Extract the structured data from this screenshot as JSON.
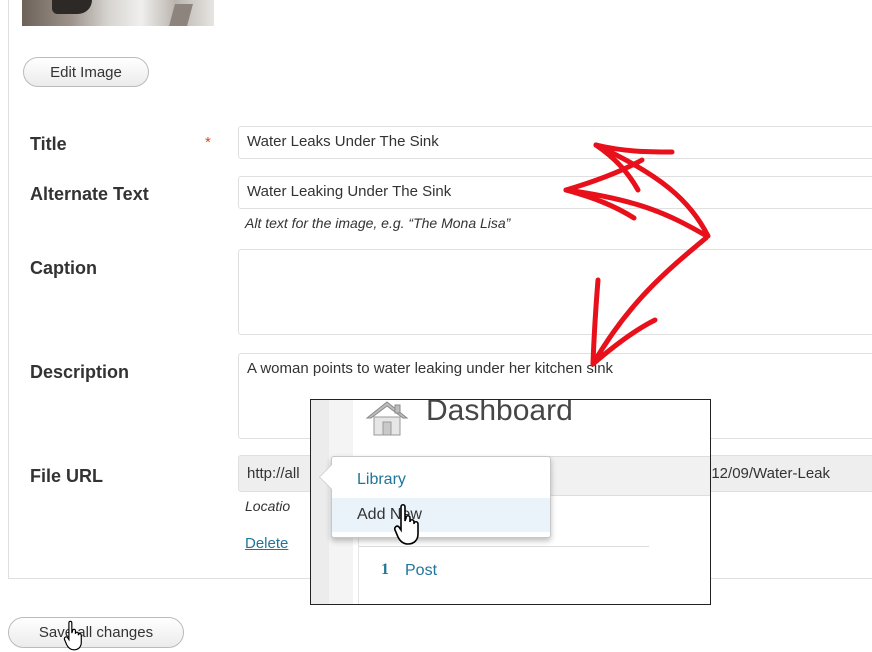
{
  "form": {
    "edit_image_label": "Edit Image",
    "required_marker": "*",
    "title": {
      "label": "Title",
      "value": "Water Leaks Under The Sink"
    },
    "alt_text": {
      "label": "Alternate Text",
      "value": "Water Leaking Under The Sink",
      "hint": "Alt text for the image, e.g. “The Mona Lisa”"
    },
    "caption": {
      "label": "Caption",
      "value": ""
    },
    "description": {
      "label": "Description",
      "value": "A woman points to water leaking under her kitchen sink"
    },
    "file_url": {
      "label": "File URL",
      "value_start": "http://all",
      "value_end": "012/09/Water-Leak",
      "hint": "Locatio"
    },
    "delete_label": "Delete",
    "save_all_label": "Save all changes"
  },
  "overlay": {
    "title": "Dashboard",
    "menu": {
      "library": "Library",
      "add_new": "Add New"
    },
    "count": "1",
    "count_label": "Post"
  },
  "colors": {
    "accent_link": "#21759b",
    "arrow_red": "#e8101a",
    "required": "#d54e21"
  },
  "icons": [
    "dashboard-house-icon",
    "hand-pointer-cursor-icon"
  ]
}
